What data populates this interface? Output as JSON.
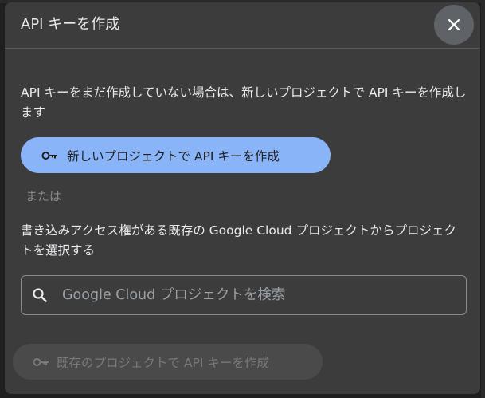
{
  "dialog": {
    "title": "API キーを作成",
    "description": "API キーをまだ作成していない場合は、新しいプロジェクトで API キーを作成します",
    "create_new_label": "新しいプロジェクトで API キーを作成",
    "or_text": "または",
    "existing_description": "書き込みアクセス権がある既存の Google Cloud プロジェクトからプロジェクトを選択する",
    "search": {
      "placeholder": "Google Cloud プロジェクトを検索",
      "value": ""
    },
    "create_existing_label": "既存のプロジェクトで API キーを作成",
    "create_existing_enabled": false
  },
  "icons": {
    "close": "close-icon",
    "key": "key-icon",
    "search": "search-icon"
  },
  "colors": {
    "dialog_bg": "#3c3c3c",
    "primary_button": "#8ab4f8",
    "disabled_button": "#4a4a4a",
    "text": "#e8eaed",
    "muted_text": "#8a8a8a"
  }
}
